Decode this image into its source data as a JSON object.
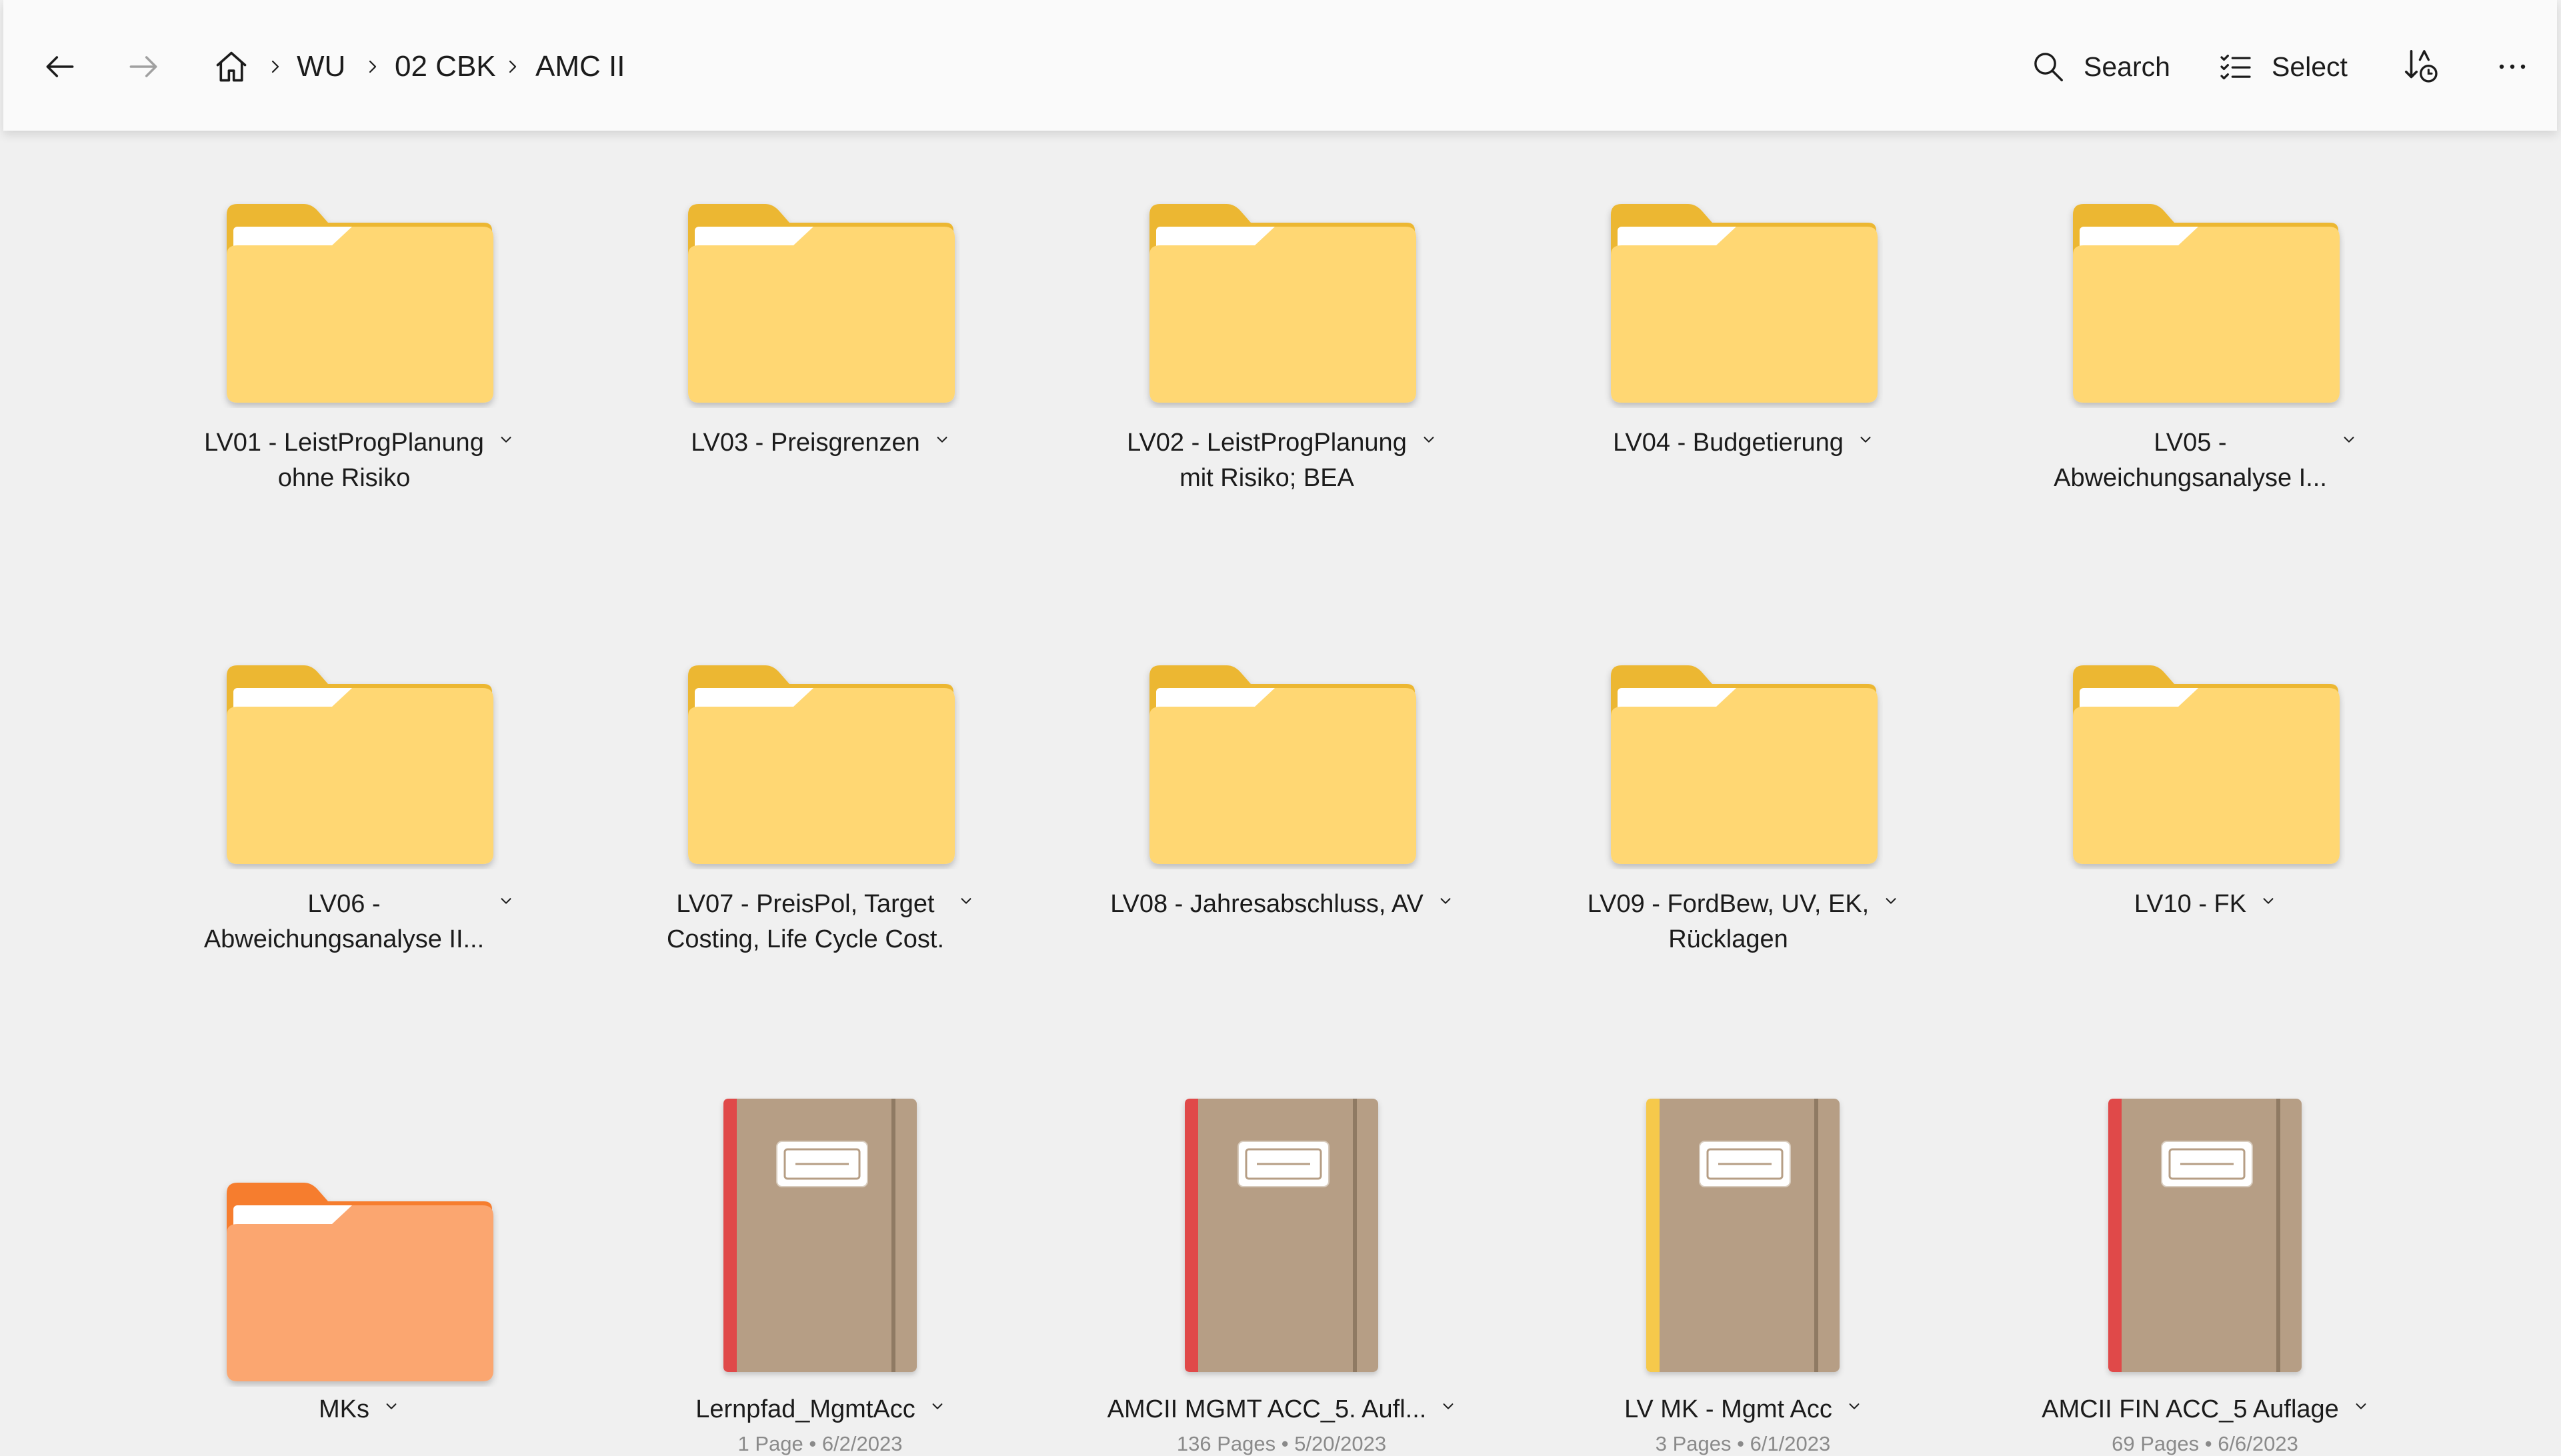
{
  "nav": {
    "back_icon": "arrow-left-icon",
    "forward_icon": "arrow-right-icon",
    "home_icon": "home-icon",
    "breadcrumb": [
      "WU",
      "02 CBK",
      "AMC II"
    ]
  },
  "toolbar": {
    "search_label": "Search",
    "select_label": "Select",
    "sort_icon": "sort-by-date-icon",
    "more_icon": "more-options-icon"
  },
  "colors": {
    "folder_yellow": "#ffd773",
    "folder_yellow_tab": "#ecb730",
    "folder_orange": "#fba66f",
    "folder_orange_tab": "#f67d2f",
    "notebook_body": "#b69e85",
    "notebook_red": "#e04848",
    "notebook_yellow": "#f6c94c"
  },
  "items": [
    {
      "type": "folder",
      "color": "yellow",
      "line1": "LV01 - LeistProgPlanung",
      "line2": "ohne Risiko"
    },
    {
      "type": "folder",
      "color": "yellow",
      "line1": "LV03 - Preisgrenzen",
      "line2": ""
    },
    {
      "type": "folder",
      "color": "yellow",
      "line1": "LV02 - LeistProgPlanung",
      "line2": "mit Risiko; BEA"
    },
    {
      "type": "folder",
      "color": "yellow",
      "line1": "LV04 - Budgetierung",
      "line2": ""
    },
    {
      "type": "folder",
      "color": "yellow",
      "line1": "LV05 -",
      "line2": "Abweichungsanalyse I..."
    },
    {
      "type": "folder",
      "color": "yellow",
      "line1": "LV06 -",
      "line2": "Abweichungsanalyse II..."
    },
    {
      "type": "folder",
      "color": "yellow",
      "line1": "LV07 - PreisPol, Target",
      "line2": "Costing, Life Cycle Cost."
    },
    {
      "type": "folder",
      "color": "yellow",
      "line1": "LV08 - Jahresabschluss, AV",
      "line2": ""
    },
    {
      "type": "folder",
      "color": "yellow",
      "line1": "LV09 - FordBew, UV, EK,",
      "line2": "Rücklagen"
    },
    {
      "type": "folder",
      "color": "yellow",
      "line1": "LV10 - FK",
      "line2": ""
    },
    {
      "type": "folder",
      "color": "orange",
      "line1": "MKs",
      "line2": ""
    },
    {
      "type": "notebook",
      "color": "red",
      "line1": "Lernpfad_MgmtAcc",
      "line2": "",
      "meta": "1 Page • 6/2/2023"
    },
    {
      "type": "notebook",
      "color": "red",
      "line1": "AMCII MGMT ACC_5. Aufl...",
      "line2": "",
      "meta": "136 Pages • 5/20/2023"
    },
    {
      "type": "notebook",
      "color": "yellow",
      "line1": "LV MK - Mgmt Acc",
      "line2": "",
      "meta": "3 Pages • 6/1/2023"
    },
    {
      "type": "notebook",
      "color": "red",
      "line1": "AMCII FIN ACC_5 Auflage",
      "line2": "",
      "meta": "69 Pages • 6/6/2023"
    }
  ]
}
